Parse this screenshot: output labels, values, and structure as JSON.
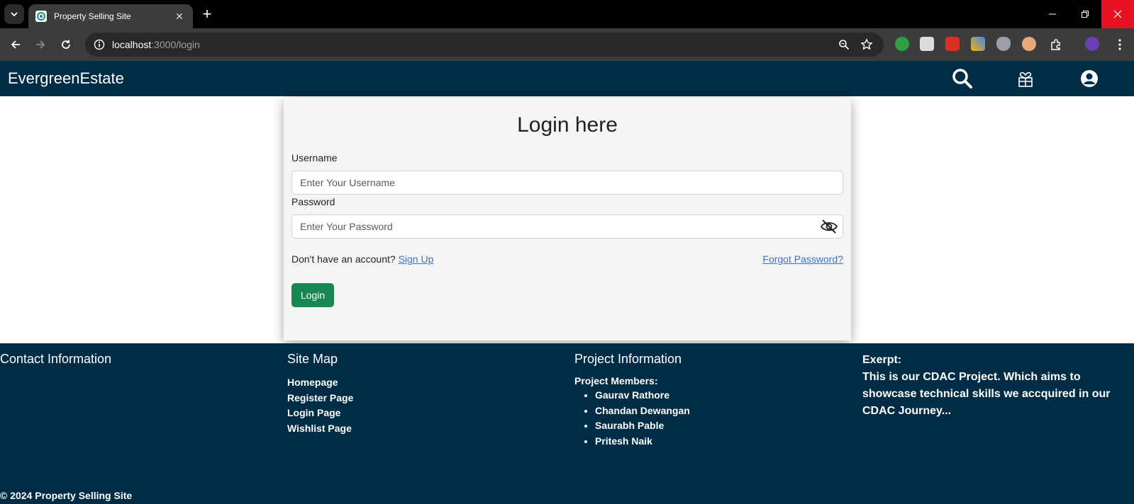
{
  "browser": {
    "tab_title": "Property Selling Site",
    "tab_close": "✕",
    "new_tab": "+",
    "url_host": "localhost",
    "url_rest": ":3000/login"
  },
  "header": {
    "brand": "EvergreenEstate"
  },
  "login": {
    "heading": "Login here",
    "username_label": "Username",
    "username_placeholder": "Enter Your Username",
    "password_label": "Password",
    "password_placeholder": "Enter Your Password",
    "no_account_text": "Don't have an account?",
    "signup_link": "Sign Up",
    "forgot_link": "Forgot Password?",
    "login_button": "Login"
  },
  "footer": {
    "contact_title": "Contact Information",
    "sitemap_title": "Site Map",
    "sitemap_links": [
      "Homepage",
      "Register Page",
      "Login Page",
      "Wishlist Page"
    ],
    "project_title": "Project Information",
    "members_title": "Project Members:",
    "members": [
      "Gaurav Rathore",
      "Chandan Dewangan",
      "Saurabh Pable",
      "Pritesh Naik"
    ],
    "exerpt_title": "Exerpt:",
    "exerpt_body": "This is our CDAC Project. Which aims to showcase technical skills we accquired in our CDAC Journey...",
    "copyright": "© 2024 Property Selling Site"
  },
  "colors": {
    "header_bg": "#002d45",
    "login_button": "#198754",
    "link": "#3b6fd6"
  }
}
